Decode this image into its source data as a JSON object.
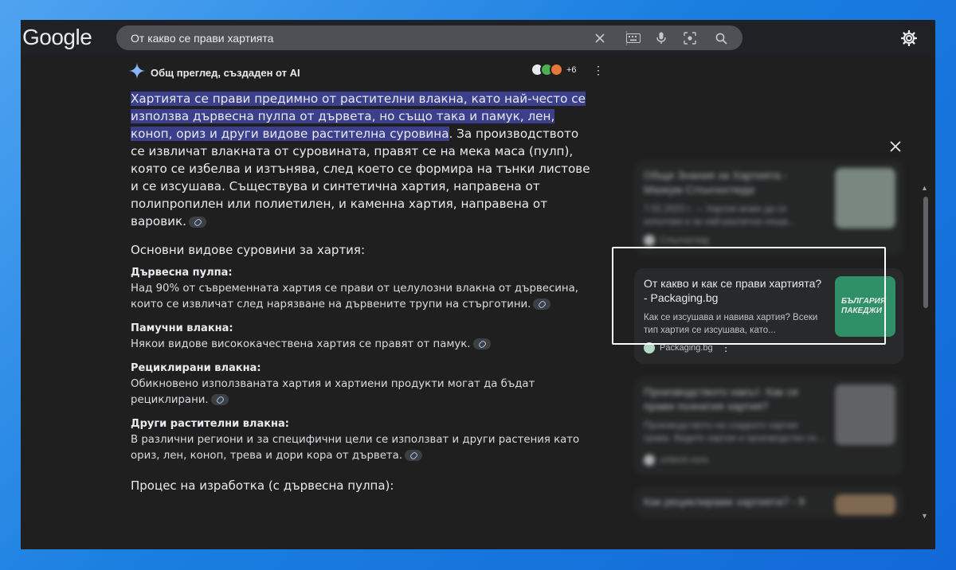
{
  "brand": {
    "logo_text": "Google"
  },
  "search": {
    "query": "От какво се прави хартията",
    "icons": [
      "close-icon",
      "keyboard-icon",
      "microphone-icon",
      "lens-icon",
      "search-icon"
    ]
  },
  "header": {
    "settings_icon": "gear-icon"
  },
  "ai_overview": {
    "title": "Общ преглед, създаден от AI",
    "sources_more": "+6",
    "lead_highlight": "Хартията се прави предимно от растителни влакна, като най-често се използва дървесна пулпа от дървета, но също така и памук, лен, коноп, ориз и други видове растителна суровина",
    "lead_rest": ". За производството се извличат влакната от суровината, правят се на мека маса (пулп), която се избелва и изтънява, след което се формира на тънки листове и се изсушава. Съществува и синтетична хартия, направена от полипропилен или полиетилен, и каменна хартия, направена от варовик.",
    "section_heading": "Основни видове суровини за хартия:",
    "items": [
      {
        "title": "Дървесна пулпа:",
        "text": "Над 90% от съвременната хартия се прави от целулозни влакна от дървесина, които се извличат след нарязване на дървените трупи на стърготини."
      },
      {
        "title": "Памучни влакна:",
        "text": "Някои видове висококачествена хартия се правят от памук."
      },
      {
        "title": "Рециклирани влакна:",
        "text": "Обикновено използваната хартия и хартиени продукти могат да бъдат рециклирани."
      },
      {
        "title": "Други растителни влакна:",
        "text": "В различни региони и за специфични цели се използват и други растения като ориз, лен, коноп, трева и дори кора от дървета."
      }
    ],
    "process_heading": "Процес на изработка (с дървесна пулпа):"
  },
  "sources_panel": {
    "focused_card": {
      "title": "От какво и как се прави хартията? - Packaging.bg",
      "desc": "Как се изсушава и навива хартия? Всеки тип хартия се изсушава, като...",
      "source": "Packaging.bg",
      "thumb_text": "БЪЛГАРИЯ ПАКЕДЖИ"
    },
    "blurred_cards": [
      {
        "title": "Общи Знания за Хартията - Мазкум Слънчогледа",
        "desc": "7.02.2023 г. — Хартия може да се използва и за най-различни неща...",
        "source": "Слънчоглед"
      },
      {
        "title": "Производството накът: Как се прави познатия хартия?",
        "desc": "Производството на сладкото хартия прави. Видите хартия и производство се...",
        "source": "unitech-vsxs"
      },
      {
        "title": "Как рециклираме хартията? - fr",
        "desc": "",
        "source": ""
      }
    ]
  }
}
